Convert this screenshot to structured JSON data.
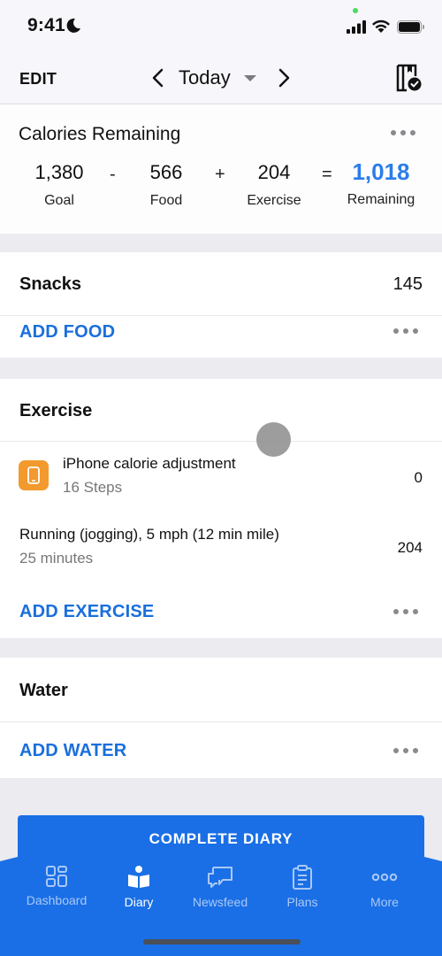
{
  "status_bar": {
    "time": "9:41"
  },
  "nav": {
    "edit_label": "EDIT",
    "date_label": "Today"
  },
  "calories": {
    "title": "Calories Remaining",
    "goal": {
      "value": "1,380",
      "label": "Goal"
    },
    "op1": "-",
    "food": {
      "value": "566",
      "label": "Food"
    },
    "op2": "+",
    "exercise": {
      "value": "204",
      "label": "Exercise"
    },
    "op3": "=",
    "remaining": {
      "value": "1,018",
      "label": "Remaining"
    },
    "remaining_color": "#2b7de9"
  },
  "snacks": {
    "title": "Snacks",
    "calories": "145",
    "add_label": "ADD FOOD"
  },
  "exercise": {
    "title": "Exercise",
    "entries": [
      {
        "name": "iPhone calorie adjustment",
        "detail": "16 Steps",
        "calories": "0",
        "icon": "iphone-icon"
      },
      {
        "name": "Running (jogging), 5 mph (12 min mile)",
        "detail": "25 minutes",
        "calories": "204"
      }
    ],
    "add_label": "ADD EXERCISE"
  },
  "water": {
    "title": "Water",
    "add_label": "ADD WATER"
  },
  "complete_button": "COMPLETE DIARY",
  "tabbar": {
    "accent": "#1a6fe6",
    "tabs": [
      {
        "label": "Dashboard",
        "icon": "dashboard-icon",
        "active": false
      },
      {
        "label": "Diary",
        "icon": "diary-icon",
        "active": true
      },
      {
        "label": "Newsfeed",
        "icon": "newsfeed-icon",
        "active": false
      },
      {
        "label": "Plans",
        "icon": "plans-icon",
        "active": false
      },
      {
        "label": "More",
        "icon": "more-icon",
        "active": false
      }
    ]
  }
}
